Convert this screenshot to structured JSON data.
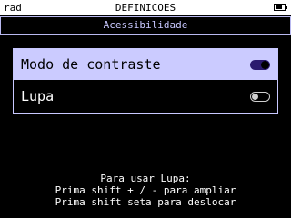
{
  "statusbar": {
    "mode": "rad",
    "title": "DEFINICOES",
    "battery_icon": "battery-icon"
  },
  "subheader": {
    "title": "Acessibilidade"
  },
  "menu": {
    "items": [
      {
        "label": "Modo de contraste",
        "state": "on",
        "selected": true
      },
      {
        "label": "Lupa",
        "state": "off",
        "selected": false
      }
    ]
  },
  "help": {
    "lines": [
      "Para usar Lupa:",
      "Prima shift + / - para ampliar",
      "Prima shift seta para deslocar"
    ]
  },
  "colors": {
    "selected_row": "#cbcbff",
    "accent": "#2b1a6e",
    "border": "#c8c8ff"
  }
}
